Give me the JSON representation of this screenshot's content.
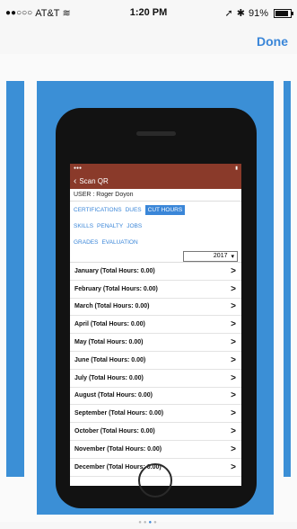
{
  "status_bar": {
    "carrier": "AT&T",
    "time": "1:20 PM",
    "battery": "91%"
  },
  "header": {
    "done_label": "Done"
  },
  "inner_app": {
    "nav_title": "Scan QR",
    "user_label": "USER : Roger Doyon",
    "tabs_row1": [
      "CERTIFICATIONS",
      "DUES",
      "CUT HOURS"
    ],
    "active_tab": "CUT HOURS",
    "tabs_row2": [
      "SKILLS",
      "PENALTY",
      "JOBS"
    ],
    "tabs_row3": [
      "GRADES",
      "EVALUATION"
    ],
    "year": "2017",
    "months": [
      "January (Total Hours: 0.00)",
      "February (Total Hours: 0.00)",
      "March (Total Hours: 0.00)",
      "April (Total Hours: 0.00)",
      "May (Total Hours: 0.00)",
      "June (Total Hours: 0.00)",
      "July (Total Hours: 0.00)",
      "August (Total Hours: 0.00)",
      "September (Total Hours: 0.00)",
      "October (Total Hours: 0.00)",
      "November (Total Hours: 0.00)",
      "December (Total Hours: 0.00)"
    ],
    "row_arrow": ">"
  },
  "pager": {
    "count": 4,
    "active_index": 2
  },
  "colors": {
    "accent": "#3a86d8",
    "nav_bar": "#8a3a2a",
    "card_bg": "#3b8fd6"
  }
}
